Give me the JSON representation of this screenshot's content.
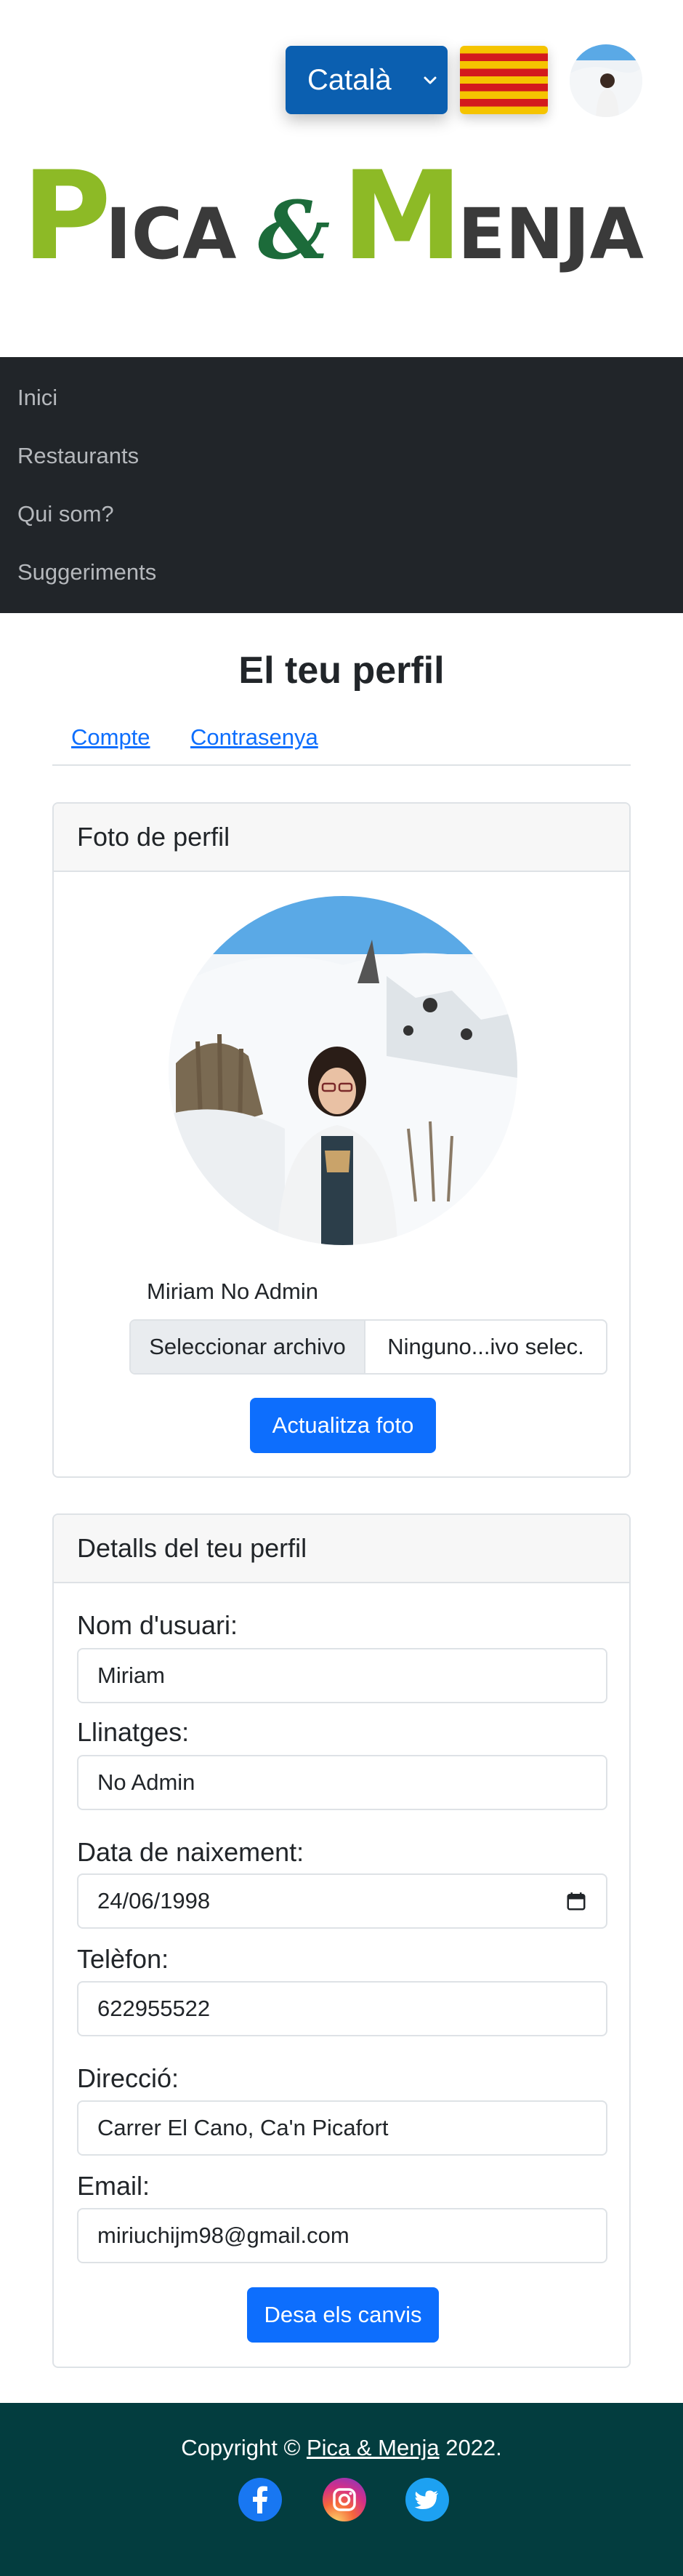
{
  "header": {
    "language": "Català",
    "logo": {
      "first_initial": "P",
      "first_rest": "ICA",
      "ampersand": "&",
      "second_initial": "M",
      "second_rest": "ENJA"
    }
  },
  "nav": {
    "items": [
      "Inici",
      "Restaurants",
      "Qui som?",
      "Suggeriments"
    ]
  },
  "page": {
    "title": "El teu perfil",
    "tabs": [
      "Compte",
      "Contrasenya"
    ]
  },
  "photo_card": {
    "header": "Foto de perfil",
    "name": "Miriam No Admin",
    "file_button": "Seleccionar archivo",
    "file_name": "Ninguno...ivo selec.",
    "submit": "Actualitza foto"
  },
  "details_card": {
    "header": "Detalls del teu perfil",
    "fields": [
      {
        "label": "Nom d'usuari:",
        "value": "Miriam"
      },
      {
        "label": "Llinatges:",
        "value": "No Admin"
      },
      {
        "label": "Data de naixement:",
        "value": "24/06/1998"
      },
      {
        "label": "Telèfon:",
        "value": "622955522"
      },
      {
        "label": "Direcció:",
        "value": "Carrer El Cano, Ca'n Picafort"
      },
      {
        "label": "Email:",
        "value": "miriuchijm98@gmail.com"
      }
    ],
    "submit": "Desa els canvis"
  },
  "footer": {
    "copyright_prefix": "Copyright © ",
    "brand_link": "Pica & Menja",
    "year": " 2022.",
    "social": [
      "facebook-icon",
      "instagram-icon",
      "twitter-icon"
    ]
  },
  "colors": {
    "logo_green_light": "#8dba26",
    "logo_green_dark": "#1c6b3a",
    "logo_text": "#3a3a3a",
    "primary": "#0d6efd",
    "navbar": "#212529",
    "footer": "#033d3f",
    "language_button": "#0b5fb0"
  }
}
